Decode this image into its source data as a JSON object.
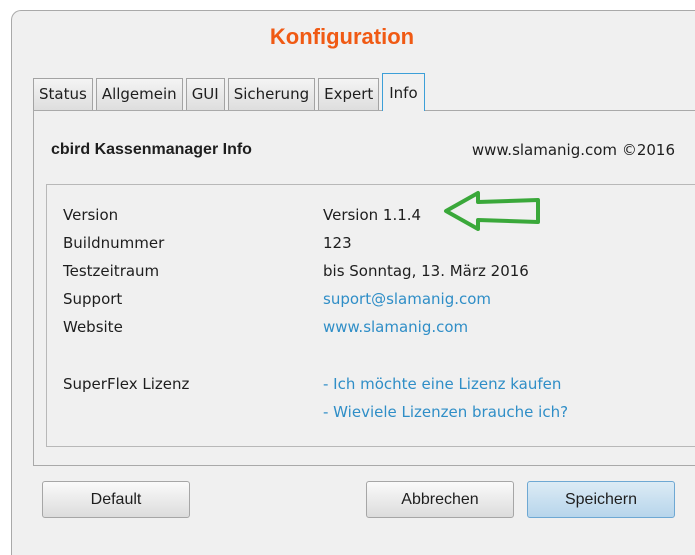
{
  "window": {
    "title": "Konfiguration"
  },
  "tabs": [
    {
      "label": "Status"
    },
    {
      "label": "Allgemein"
    },
    {
      "label": "GUI"
    },
    {
      "label": "Sicherung"
    },
    {
      "label": "Expert"
    },
    {
      "label": "Info",
      "active": true
    }
  ],
  "info": {
    "heading": "cbird Kassenmanager Info",
    "copyright": "www.slamanig.com ©2016",
    "rows": [
      {
        "label": "Version",
        "value": "Version 1.1.4"
      },
      {
        "label": "Buildnummer",
        "value": "123"
      },
      {
        "label": "Testzeitraum",
        "value": "bis Sonntag, 13. März 2016"
      },
      {
        "label": "Support",
        "value": "suport@slamanig.com"
      },
      {
        "label": "Website",
        "value": "www.slamanig.com"
      }
    ],
    "license": {
      "label": "SuperFlex Lizenz",
      "links": [
        "- Ich möchte eine Lizenz kaufen",
        "- Wieviele Lizenzen brauche ich?"
      ]
    }
  },
  "buttons": {
    "default": "Default",
    "cancel": "Abbrechen",
    "save": "Speichern"
  },
  "annotation": {
    "arrow_color": "#3aa83a",
    "arrow_icon": "arrow-left-icon"
  },
  "colors": {
    "title": "#f05a14",
    "link": "#2f8ec7",
    "active_tab_border": "#3c9fd8"
  }
}
